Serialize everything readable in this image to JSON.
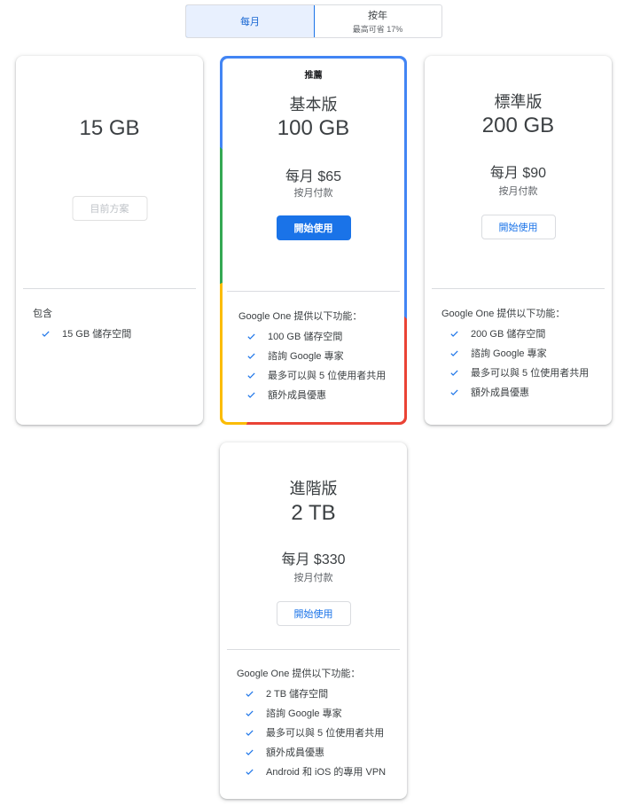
{
  "toggle": {
    "monthly_label": "每月",
    "yearly_label": "按年",
    "yearly_sub": "最高可省 17%"
  },
  "colors": {
    "accent": "#1a73e8",
    "google_blue": "#4285f4",
    "google_red": "#ea4335",
    "google_yellow": "#fbbc04",
    "google_green": "#34a853"
  },
  "plans": [
    {
      "name": "",
      "size": "15 GB",
      "button": "目前方案",
      "features_title": "包含",
      "features": [
        "15 GB 儲存空間"
      ]
    },
    {
      "badge": "推薦",
      "name": "基本版",
      "size": "100 GB",
      "price": "每月 $65",
      "billed": "按月付款",
      "button": "開始使用",
      "features_title": "Google One 提供以下功能：",
      "features": [
        "100 GB 儲存空間",
        "諮詢 Google 專家",
        "最多可以與 5 位使用者共用",
        "額外成員優惠"
      ]
    },
    {
      "name": "標準版",
      "size": "200 GB",
      "price": "每月 $90",
      "billed": "按月付款",
      "button": "開始使用",
      "features_title": "Google One 提供以下功能：",
      "features": [
        "200 GB 儲存空間",
        "諮詢 Google 專家",
        "最多可以與 5 位使用者共用",
        "額外成員優惠"
      ]
    },
    {
      "name": "進階版",
      "size": "2 TB",
      "price": "每月 $330",
      "billed": "按月付款",
      "button": "開始使用",
      "features_title": "Google One 提供以下功能：",
      "features": [
        "2 TB 儲存空間",
        "諮詢 Google 專家",
        "最多可以與 5 位使用者共用",
        "額外成員優惠",
        "Android 和 iOS 的專用 VPN"
      ]
    }
  ]
}
